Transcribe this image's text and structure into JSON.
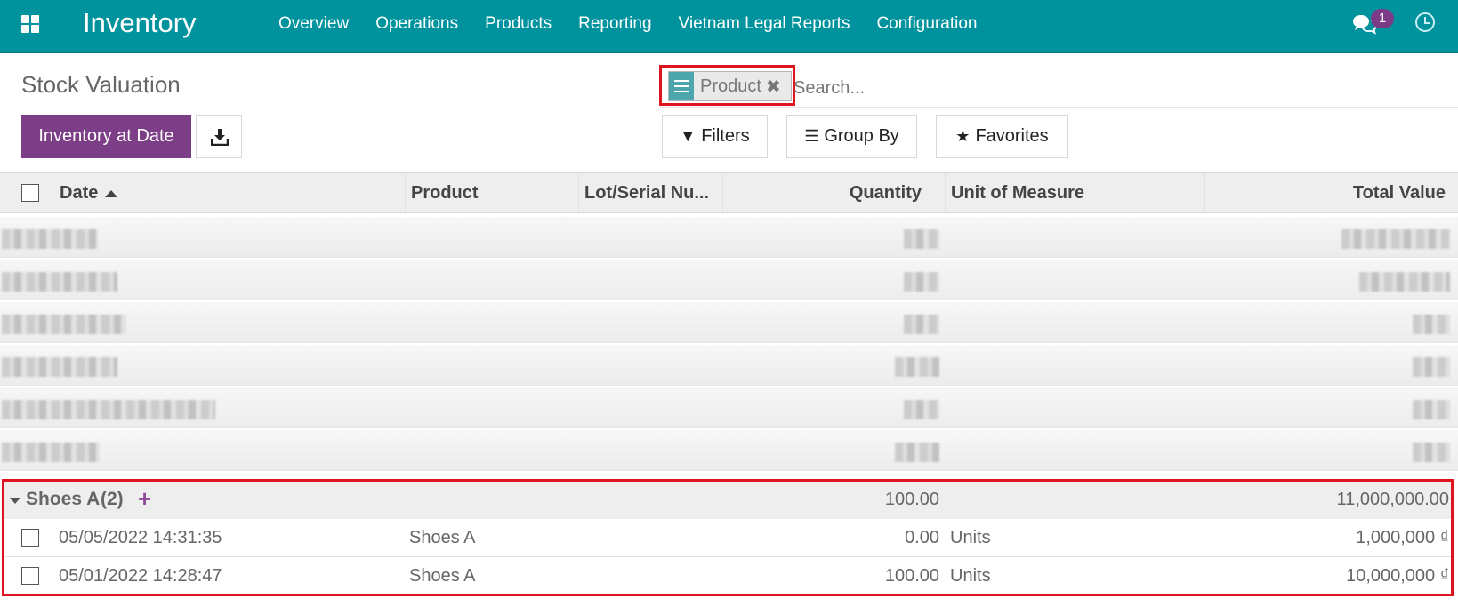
{
  "navbar": {
    "brand": "Inventory",
    "menu": [
      "Overview",
      "Operations",
      "Products",
      "Reporting",
      "Vietnam Legal Reports",
      "Configuration"
    ],
    "chat_count": "1"
  },
  "control_panel": {
    "title": "Stock Valuation",
    "facet_label": "Product",
    "search_placeholder": "Search...",
    "inventory_at_date_label": "Inventory at Date",
    "filters_label": "Filters",
    "group_by_label": "Group By",
    "favorites_label": "Favorites"
  },
  "table": {
    "columns": [
      "Date",
      "Product",
      "Lot/Serial Nu...",
      "Quantity",
      "Unit of Measure",
      "Total Value"
    ],
    "group": {
      "name": "Shoes A",
      "count": "(2)",
      "quantity": "100.00",
      "total_value": "11,000,000.00"
    },
    "rows": [
      {
        "date": "05/05/2022 14:31:35",
        "product": "Shoes A",
        "quantity": "0.00",
        "uom": "Units",
        "total_value": "1,000,000 ₫"
      },
      {
        "date": "05/01/2022 14:28:47",
        "product": "Shoes A",
        "quantity": "100.00",
        "uom": "Units",
        "total_value": "10,000,000 ₫"
      }
    ]
  },
  "icons": {
    "apps": "apps-grid-icon",
    "chat": "chat-icon",
    "clock": "clock-icon",
    "download": "download-icon",
    "filter": "filter-icon",
    "group": "bars-icon",
    "star": "star-icon"
  },
  "colors": {
    "navbar": "#00939e",
    "primary": "#7c3e86",
    "highlight": "#e0141e"
  }
}
